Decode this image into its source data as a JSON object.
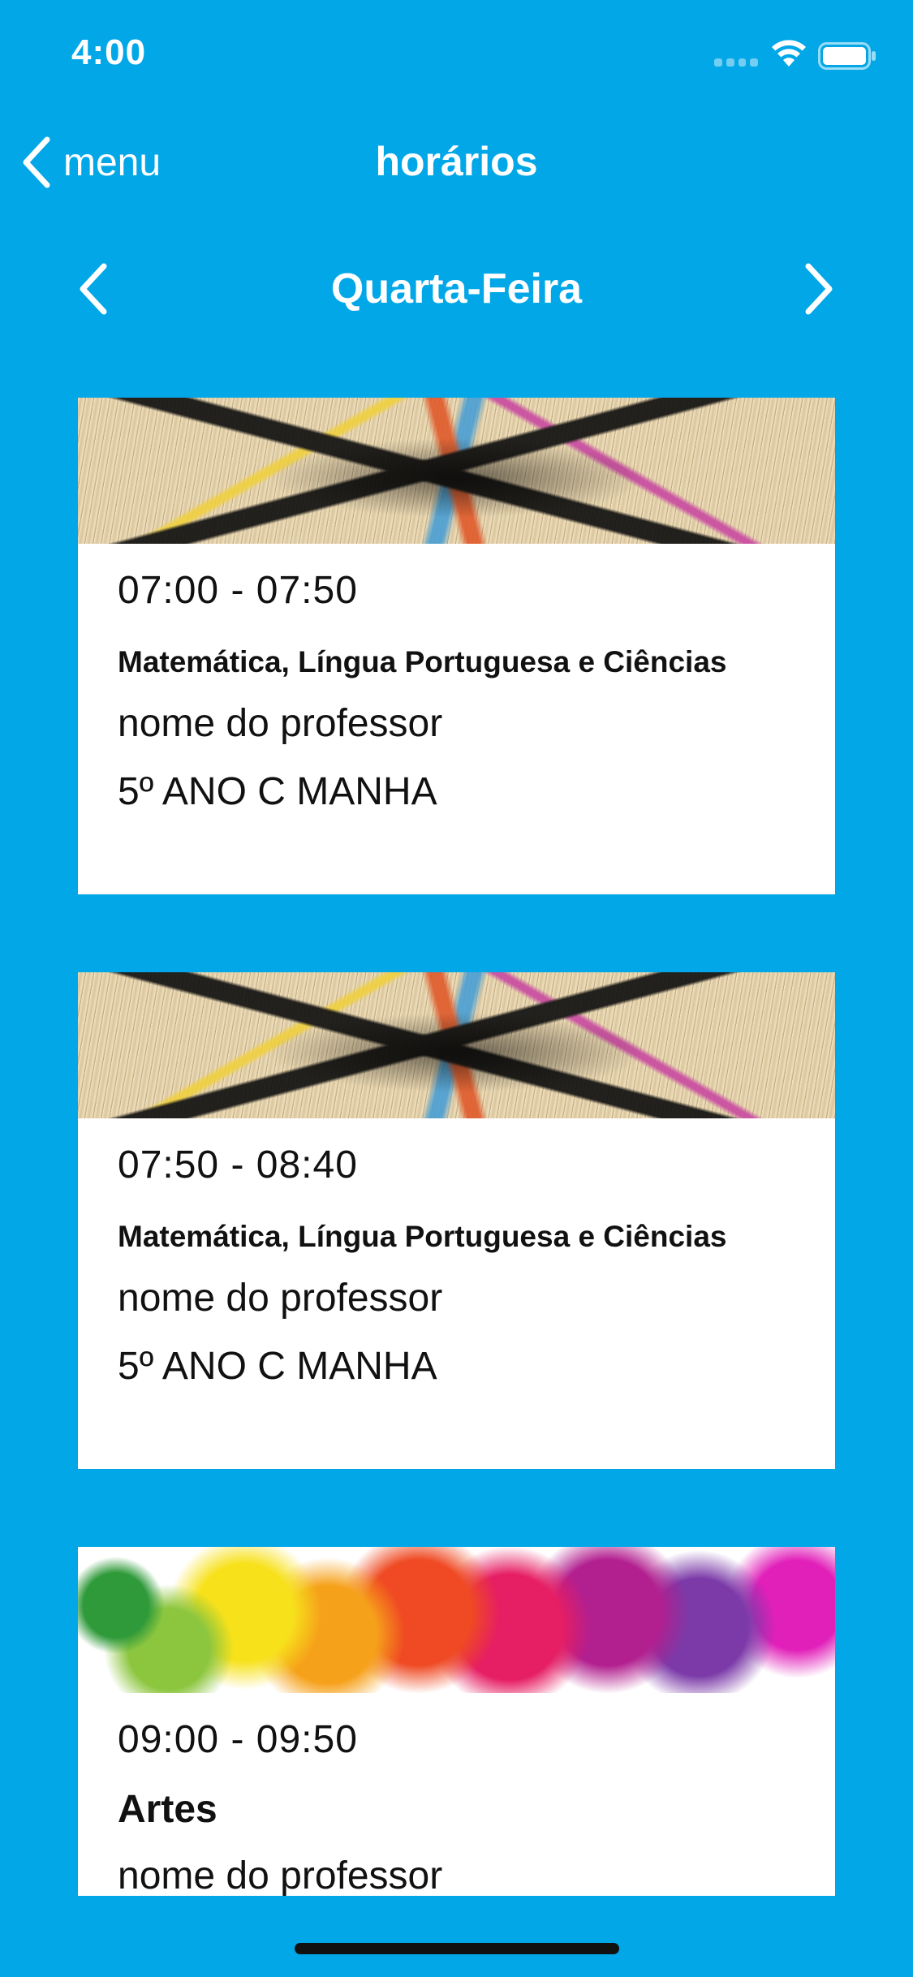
{
  "status_bar": {
    "time": "4:00"
  },
  "nav": {
    "back_label": "menu",
    "title": "horários"
  },
  "day_selector": {
    "day": "Quarta-Feira"
  },
  "schedule": [
    {
      "time": "07:00 - 07:50",
      "subject": "Matemática, Língua Portuguesa e Ciências",
      "teacher": "nome do professor",
      "class": "5º ANO C MANHA",
      "banner": "books-image"
    },
    {
      "time": "07:50 - 08:40",
      "subject": "Matemática, Língua Portuguesa e Ciências",
      "teacher": "nome do professor",
      "class": "5º ANO C MANHA",
      "banner": "books-image"
    },
    {
      "time": "09:00 - 09:50",
      "subject": "Artes",
      "teacher": "nome do professor",
      "banner": "paint-splash-image"
    }
  ],
  "colors": {
    "background": "#02a7e8",
    "card": "#ffffff",
    "text_light": "#ffffff",
    "text_dark": "#111111"
  }
}
